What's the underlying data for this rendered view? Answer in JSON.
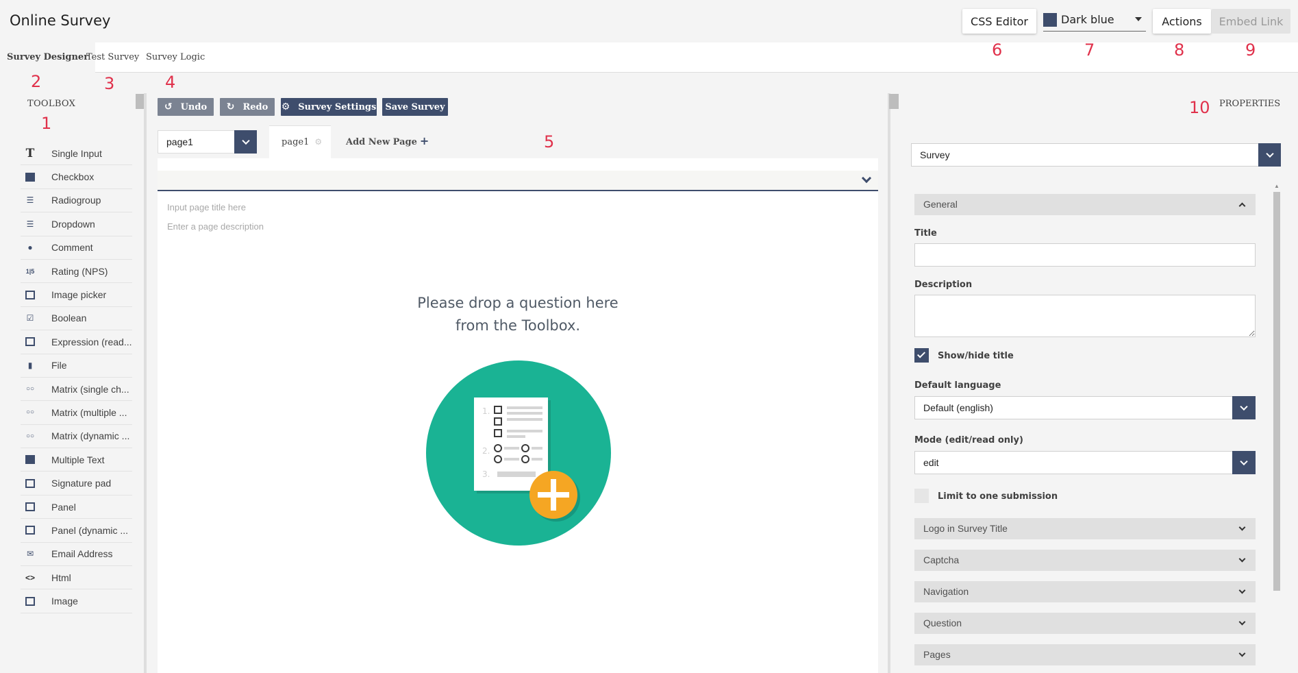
{
  "app": {
    "title": "Online Survey"
  },
  "header": {
    "css_editor": "CSS Editor",
    "theme": {
      "selected": "Dark blue",
      "swatch_color": "#3e4d6c"
    },
    "actions": "Actions",
    "embed_link": "Embed Link"
  },
  "tabs": [
    {
      "label": "Survey Designer",
      "active": true
    },
    {
      "label": "Test Survey",
      "active": false
    },
    {
      "label": "Survey Logic",
      "active": false
    }
  ],
  "markers": [
    "1",
    "2",
    "3",
    "4",
    "5",
    "6",
    "7",
    "8",
    "9",
    "10"
  ],
  "toolbox": {
    "title": "TOOLBOX",
    "items": [
      {
        "label": "Single Input",
        "icon": "text-T-icon"
      },
      {
        "label": "Checkbox",
        "icon": "checkbox-icon"
      },
      {
        "label": "Radiogroup",
        "icon": "radiogroup-icon"
      },
      {
        "label": "Dropdown",
        "icon": "dropdown-icon"
      },
      {
        "label": "Comment",
        "icon": "comment-icon"
      },
      {
        "label": "Rating (NPS)",
        "icon": "rating-icon"
      },
      {
        "label": "Image picker",
        "icon": "image-picker-icon"
      },
      {
        "label": "Boolean",
        "icon": "boolean-icon"
      },
      {
        "label": "Expression (read...",
        "icon": "expression-icon"
      },
      {
        "label": "File",
        "icon": "file-icon"
      },
      {
        "label": "Matrix (single ch...",
        "icon": "matrix-icon"
      },
      {
        "label": "Matrix (multiple ...",
        "icon": "matrix-multiple-icon"
      },
      {
        "label": "Matrix (dynamic ...",
        "icon": "matrix-dynamic-icon"
      },
      {
        "label": "Multiple Text",
        "icon": "multiple-text-icon"
      },
      {
        "label": "Signature pad",
        "icon": "signature-icon"
      },
      {
        "label": "Panel",
        "icon": "panel-icon"
      },
      {
        "label": "Panel (dynamic ...",
        "icon": "panel-dynamic-icon"
      },
      {
        "label": "Email Address",
        "icon": "email-icon"
      },
      {
        "label": "Html",
        "icon": "html-icon"
      },
      {
        "label": "Image",
        "icon": "image-icon"
      }
    ]
  },
  "editor_toolbar": {
    "undo": "Undo",
    "redo": "Redo",
    "survey_settings": "Survey Settings",
    "save_survey": "Save Survey"
  },
  "pages": {
    "selected": "page1",
    "tab_label": "page1",
    "add_new_page": "Add New Page"
  },
  "canvas": {
    "title_placeholder": "Input page title here",
    "description_placeholder": "Enter a page description",
    "drop_message_line1": "Please drop a question here",
    "drop_message_line2": "from the Toolbox."
  },
  "properties": {
    "title": "PROPERTIES",
    "object_selected": "Survey",
    "general_group": "General",
    "title_label": "Title",
    "title_value": "",
    "description_label": "Description",
    "show_hide_title": "Show/hide title",
    "show_hide_title_checked": true,
    "default_language_label": "Default language",
    "default_language_value": "Default (english)",
    "mode_label": "Mode (edit/read only)",
    "mode_value": "edit",
    "limit_one_submission": "Limit to one submission",
    "limit_one_submission_checked": false,
    "groups": [
      "Logo in Survey Title",
      "Captcha",
      "Navigation",
      "Question",
      "Pages"
    ]
  }
}
